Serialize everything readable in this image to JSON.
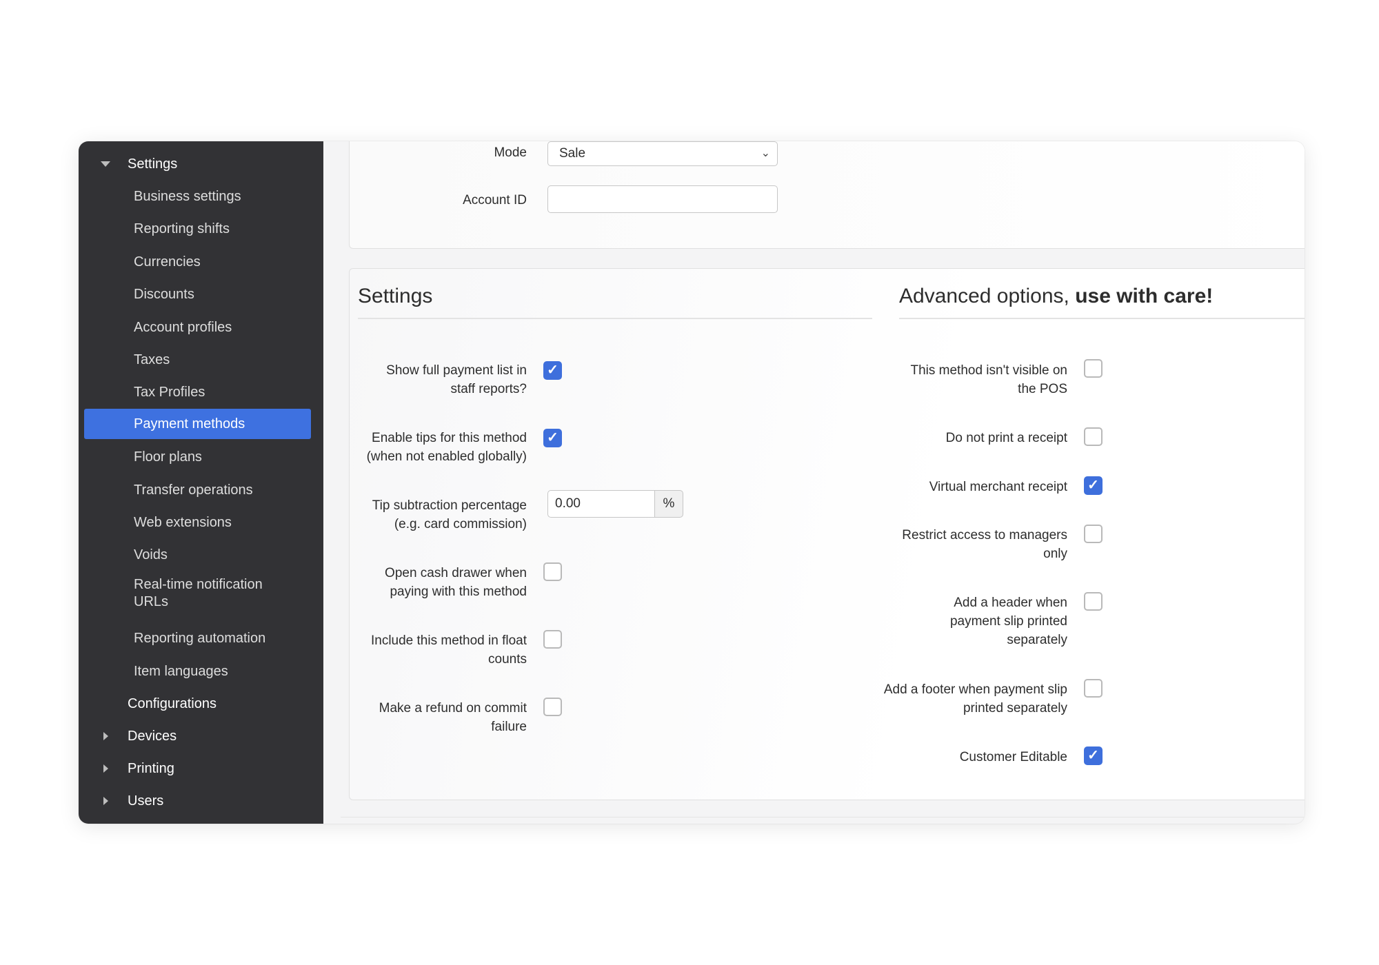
{
  "sidebar": {
    "settings": "Settings",
    "items": [
      "Business settings",
      "Reporting shifts",
      "Currencies",
      "Discounts",
      "Account profiles",
      "Taxes",
      "Tax Profiles",
      "Payment methods",
      "Floor plans",
      "Transfer operations",
      "Web extensions",
      "Voids",
      "Real-time notification URLs",
      "Reporting automation",
      "Item languages"
    ],
    "active_item": "Payment methods",
    "configurations": "Configurations",
    "devices": "Devices",
    "printing": "Printing",
    "users": "Users"
  },
  "top_form": {
    "mode_label": "Mode",
    "mode_value": "Sale",
    "account_id_label": "Account ID",
    "account_id_value": ""
  },
  "settings_section": {
    "title": "Settings",
    "fields": [
      {
        "label": "Show full payment list in staff reports?",
        "checked": true
      },
      {
        "label": "Enable tips for this method (when not enabled globally)",
        "checked": true
      },
      {
        "label": "Tip subtraction percentage (e.g. card commission)",
        "value": "0.00",
        "unit": "%"
      },
      {
        "label": "Open cash drawer when paying with this method",
        "checked": false
      },
      {
        "label": "Include this method in float counts",
        "checked": false
      },
      {
        "label": "Make a refund on commit failure",
        "checked": false
      }
    ]
  },
  "advanced_section": {
    "title_prefix": "Advanced options, ",
    "title_emphasis": "use with care!",
    "fields": [
      {
        "label": "This method isn't visible on the POS",
        "checked": false
      },
      {
        "label": "Do not print a receipt",
        "checked": false
      },
      {
        "label": "Virtual merchant receipt",
        "checked": true
      },
      {
        "label": "Restrict access to managers only",
        "checked": false
      },
      {
        "label": "Add a header when payment slip printed separately",
        "checked": false
      },
      {
        "label": "Add a footer when payment slip printed separately",
        "checked": false
      },
      {
        "label": "Customer Editable",
        "checked": true
      }
    ]
  },
  "colors": {
    "sidebar_bg": "#323235",
    "accent": "#3e71e0"
  }
}
